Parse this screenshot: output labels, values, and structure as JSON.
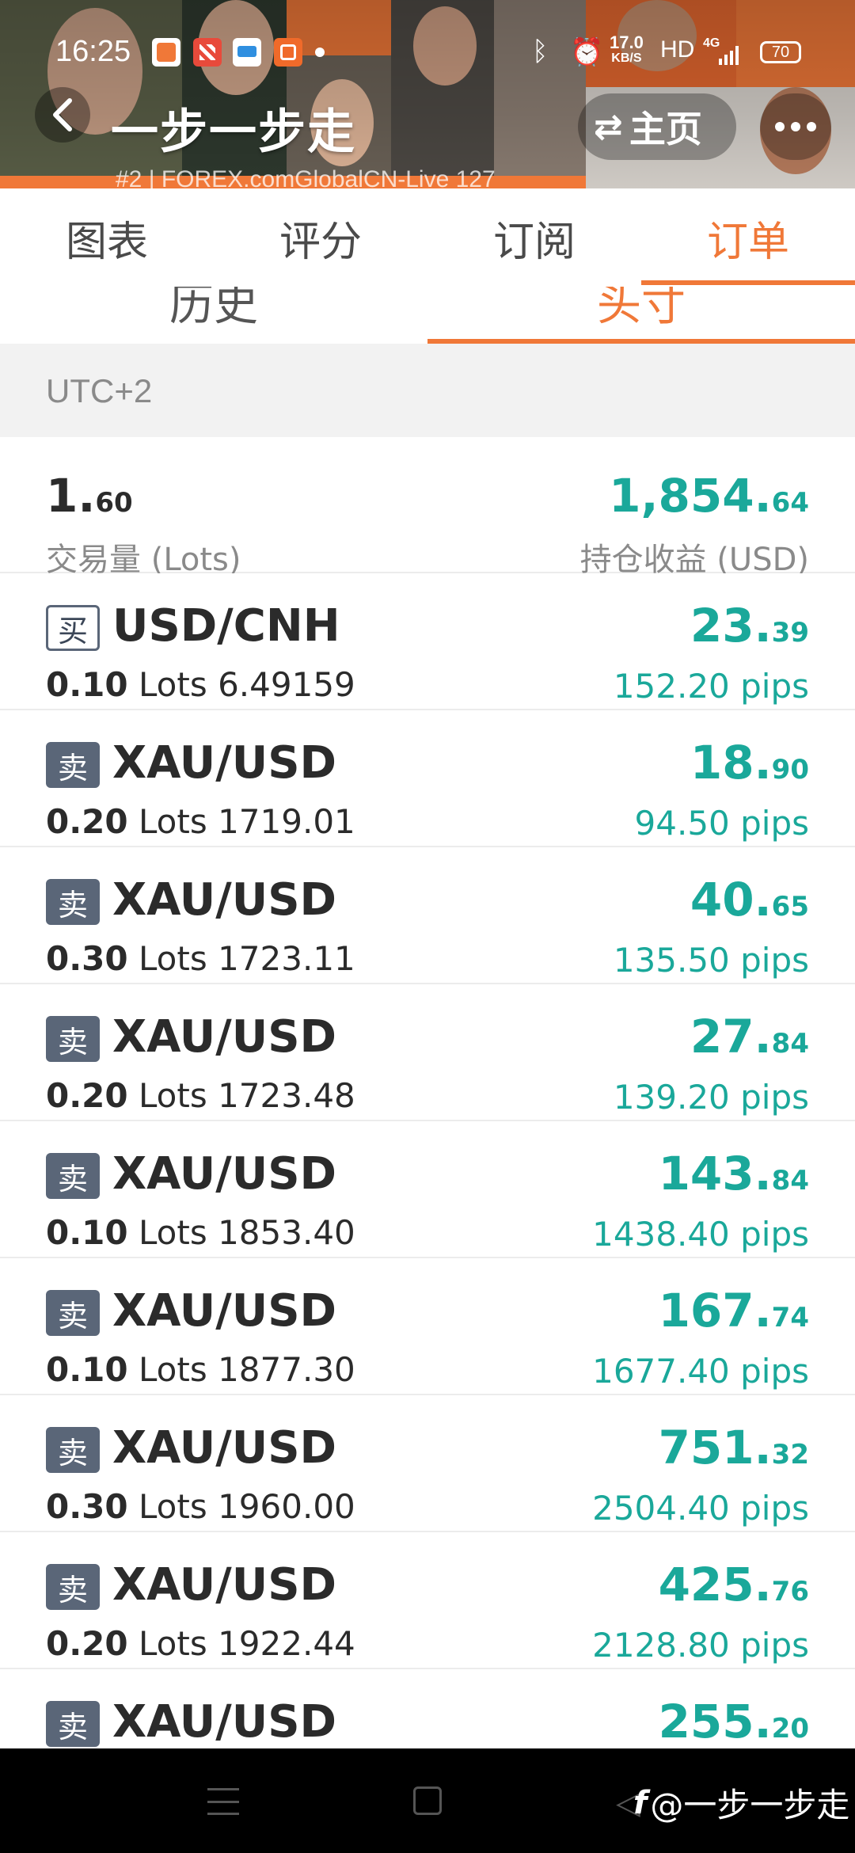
{
  "status_bar": {
    "time": "16:25",
    "net_speed_value": "17.0",
    "net_speed_unit": "KB/S",
    "hd_label": "HD",
    "network_label": "4G",
    "battery": "70"
  },
  "header": {
    "title": "一步一步走",
    "home_label": "主页",
    "server_label": "#2 | FOREX.comGlobalCN-Live 127"
  },
  "main_tabs": [
    {
      "label": "图表",
      "active": false
    },
    {
      "label": "评分",
      "active": false
    },
    {
      "label": "订阅",
      "active": false
    },
    {
      "label": "订单",
      "active": true
    }
  ],
  "sub_tabs": [
    {
      "label": "历史",
      "active": false
    },
    {
      "label": "头寸",
      "active": true
    }
  ],
  "timezone": "UTC+2",
  "summary": {
    "volume_int": "1.",
    "volume_dec": "60",
    "volume_label": "交易量 (Lots)",
    "profit_int": "1,854.",
    "profit_dec": "64",
    "profit_label": "持仓收益 (USD)"
  },
  "lots_unit": "Lots",
  "orders": [
    {
      "side": "buy",
      "side_label": "买",
      "symbol": "USD/CNH",
      "lots": "0.10",
      "price": "6.49159",
      "profit_int": "23.",
      "profit_dec": "39",
      "pips": "152.20 pips"
    },
    {
      "side": "sell",
      "side_label": "卖",
      "symbol": "XAU/USD",
      "lots": "0.20",
      "price": "1719.01",
      "profit_int": "18.",
      "profit_dec": "90",
      "pips": "94.50 pips"
    },
    {
      "side": "sell",
      "side_label": "卖",
      "symbol": "XAU/USD",
      "lots": "0.30",
      "price": "1723.11",
      "profit_int": "40.",
      "profit_dec": "65",
      "pips": "135.50 pips"
    },
    {
      "side": "sell",
      "side_label": "卖",
      "symbol": "XAU/USD",
      "lots": "0.20",
      "price": "1723.48",
      "profit_int": "27.",
      "profit_dec": "84",
      "pips": "139.20 pips"
    },
    {
      "side": "sell",
      "side_label": "卖",
      "symbol": "XAU/USD",
      "lots": "0.10",
      "price": "1853.40",
      "profit_int": "143.",
      "profit_dec": "84",
      "pips": "1438.40 pips"
    },
    {
      "side": "sell",
      "side_label": "卖",
      "symbol": "XAU/USD",
      "lots": "0.10",
      "price": "1877.30",
      "profit_int": "167.",
      "profit_dec": "74",
      "pips": "1677.40 pips"
    },
    {
      "side": "sell",
      "side_label": "卖",
      "symbol": "XAU/USD",
      "lots": "0.30",
      "price": "1960.00",
      "profit_int": "751.",
      "profit_dec": "32",
      "pips": "2504.40 pips"
    },
    {
      "side": "sell",
      "side_label": "卖",
      "symbol": "XAU/USD",
      "lots": "0.20",
      "price": "1922.44",
      "profit_int": "425.",
      "profit_dec": "76",
      "pips": "2128.80 pips"
    },
    {
      "side": "sell",
      "side_label": "卖",
      "symbol": "XAU/USD",
      "lots": "",
      "price": "",
      "profit_int": "255.",
      "profit_dec": "20",
      "pips": ""
    }
  ],
  "watermark": {
    "logo": "f",
    "text": "@一步一步走"
  },
  "colors": {
    "accent": "#f07838",
    "profit": "#1aa89a",
    "badge": "#5a6678"
  }
}
